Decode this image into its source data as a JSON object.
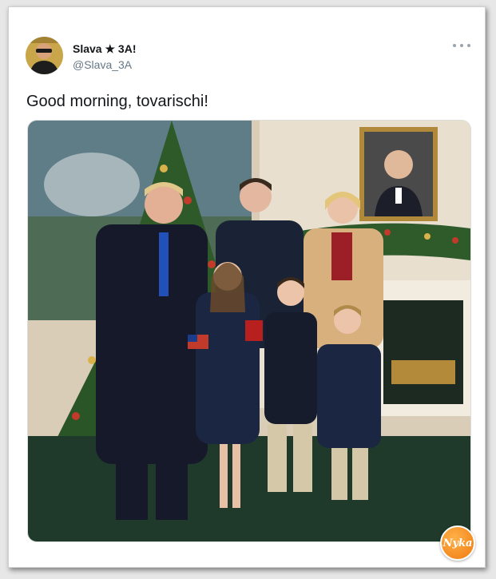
{
  "tweet": {
    "display_name": "Slava ★ 3A!",
    "handle": "@Slava_3A",
    "text": "Good morning, tovarischi!",
    "more_icon": "more-horizontal-icon",
    "photo_alt": "Family portrait in front of a Christmas tree with a framed portrait above the fireplace"
  },
  "watermark": {
    "text": "Nyka"
  },
  "colors": {
    "text_primary": "#14171a",
    "text_secondary": "#657786",
    "watermark": "#f07a10"
  }
}
